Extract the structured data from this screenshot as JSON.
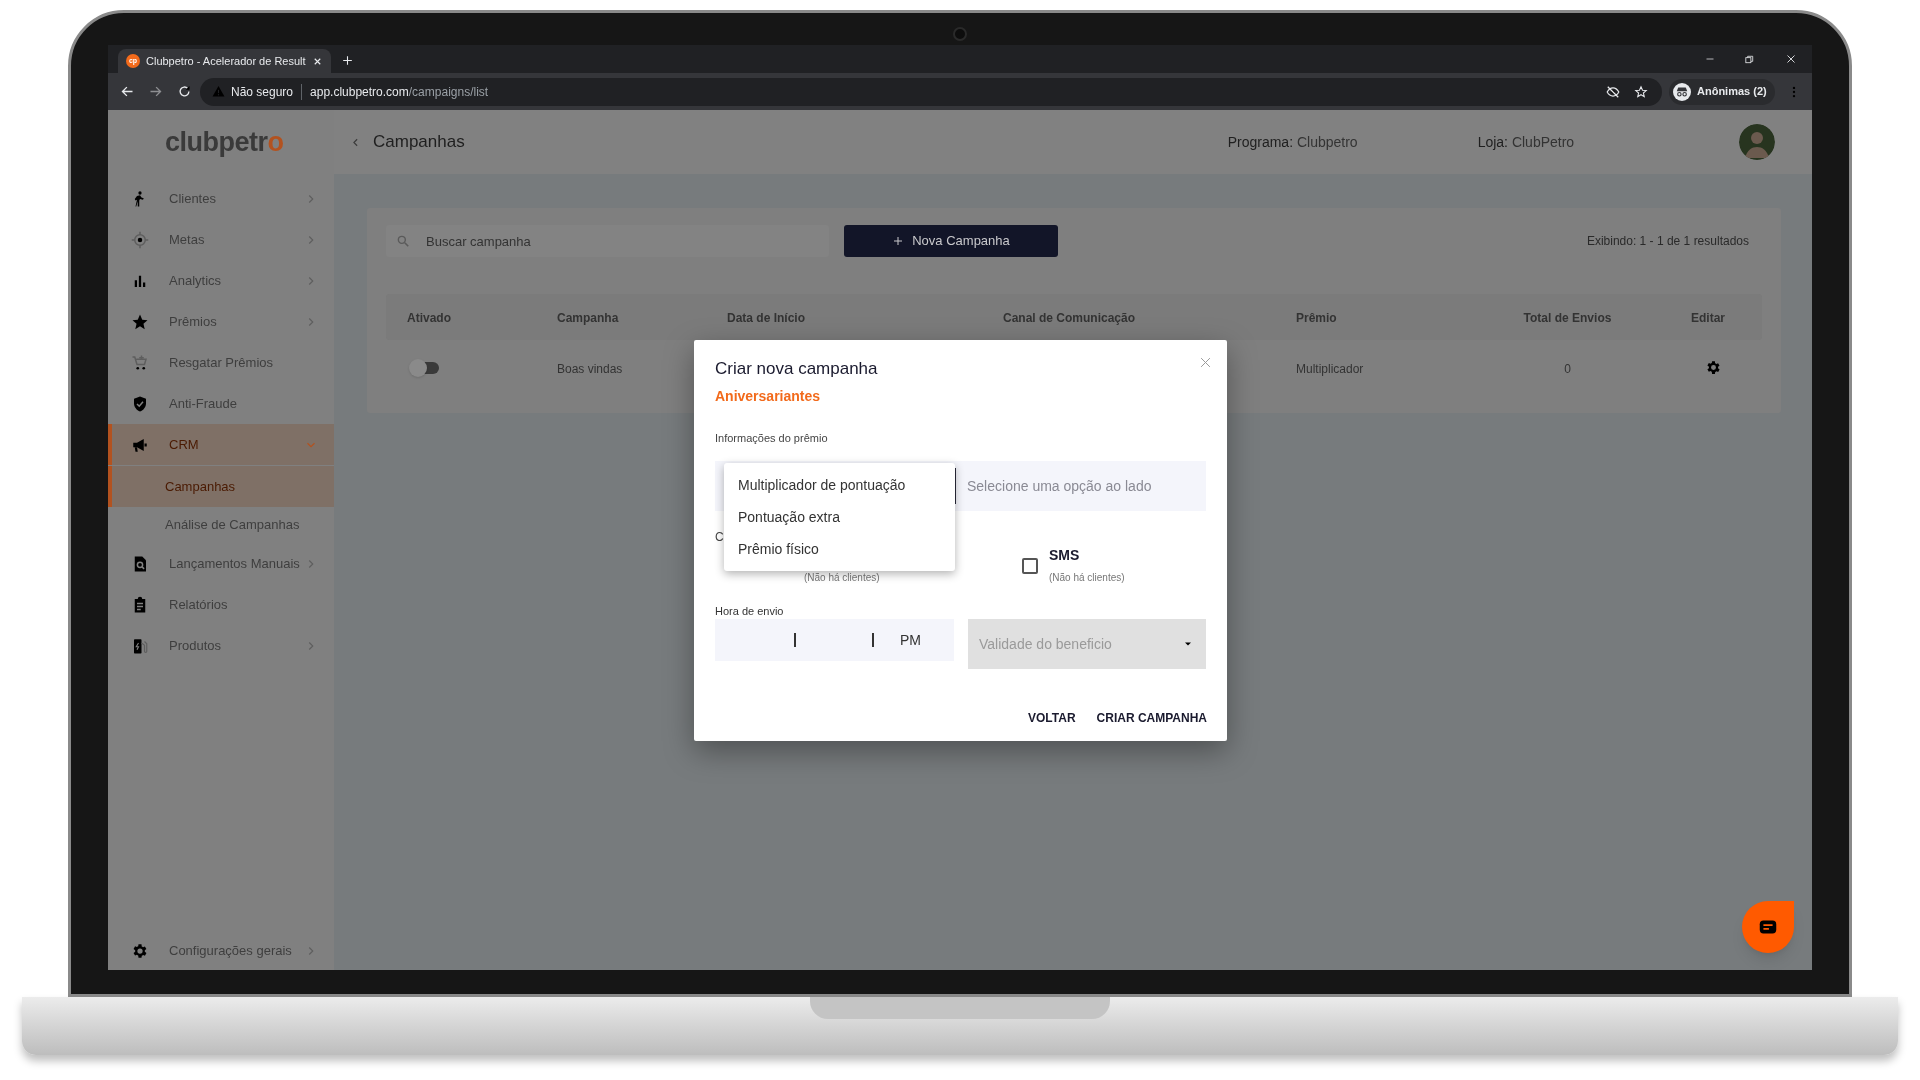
{
  "browser": {
    "tab": {
      "favicon": "cp",
      "title": "Clubpetro - Acelerador de Result"
    },
    "security": "Não seguro",
    "url_host": "app.clubpetro.com",
    "url_path": "/campaigns/list",
    "profile": "Anônimas (2)"
  },
  "sidebar": {
    "logo": {
      "text": "clubpetr",
      "accent": "o"
    },
    "items": [
      {
        "label": "Clientes",
        "kind": "group",
        "expanded": false,
        "selected": false
      },
      {
        "label": "Metas",
        "kind": "group",
        "expanded": false,
        "selected": false
      },
      {
        "label": "Analytics",
        "kind": "group",
        "expanded": false,
        "selected": false
      },
      {
        "label": "Prêmios",
        "kind": "group",
        "expanded": false,
        "selected": false
      },
      {
        "label": "Resgatar Prêmios",
        "kind": "link",
        "selected": false
      },
      {
        "label": "Anti-Fraude",
        "kind": "link",
        "selected": false
      },
      {
        "label": "CRM",
        "kind": "group",
        "expanded": true,
        "selected": true,
        "children": [
          {
            "label": "Campanhas",
            "selected": true
          },
          {
            "label": "Análise de Campanhas",
            "selected": false
          }
        ]
      },
      {
        "label": "Lançamentos Manuais",
        "kind": "group",
        "expanded": false,
        "selected": false
      },
      {
        "label": "Relatórios",
        "kind": "link",
        "selected": false
      },
      {
        "label": "Produtos",
        "kind": "group",
        "expanded": false,
        "selected": false
      }
    ],
    "footer": {
      "label": "Configurações gerais",
      "kind": "group",
      "expanded": false,
      "selected": false
    }
  },
  "header": {
    "title": "Campanhas",
    "program_label": "Programa:",
    "program": "Clubpetro",
    "store_label": "Loja:",
    "store": "ClubPetro"
  },
  "toolbar": {
    "search": {
      "placeholder": "Buscar campanha"
    },
    "new_button": "Nova Campanha",
    "result_count": "Exibindo: 1 - 1 de 1 resultados"
  },
  "table": {
    "columns": [
      "Ativado",
      "Campanha",
      "Data de Início",
      "Canal de Comunicação",
      "Prêmio",
      "Total de Envios",
      "Editar"
    ],
    "rows": [
      {
        "enabled": false,
        "campaign": "Boas vindas",
        "prize": "Multiplicador",
        "total_sent": "0"
      }
    ]
  },
  "modal": {
    "title": "Criar nova campanha",
    "subtitle": "Aniversariantes",
    "prize_section": "Informações do prêmio",
    "prize_value": {
      "placeholder": "Selecione uma opção ao lado"
    },
    "prize_options": [
      {
        "label": "Multiplicador de pontuação",
        "selected": false
      },
      {
        "label": "Pontuação extra",
        "selected": false
      },
      {
        "label": "Prêmio físico",
        "selected": false
      }
    ],
    "channels_label": "C",
    "channels": [
      {
        "note": "(Não há clientes)"
      },
      {
        "name": "SMS",
        "checked": false,
        "note": "(Não há clientes)"
      }
    ],
    "send_time_label": "Hora de envio",
    "send_time_period": "PM",
    "validity": {
      "placeholder": "Validade do beneficio"
    },
    "buttons": [
      "VOLTAR",
      "CRIAR CAMPANHA"
    ]
  }
}
